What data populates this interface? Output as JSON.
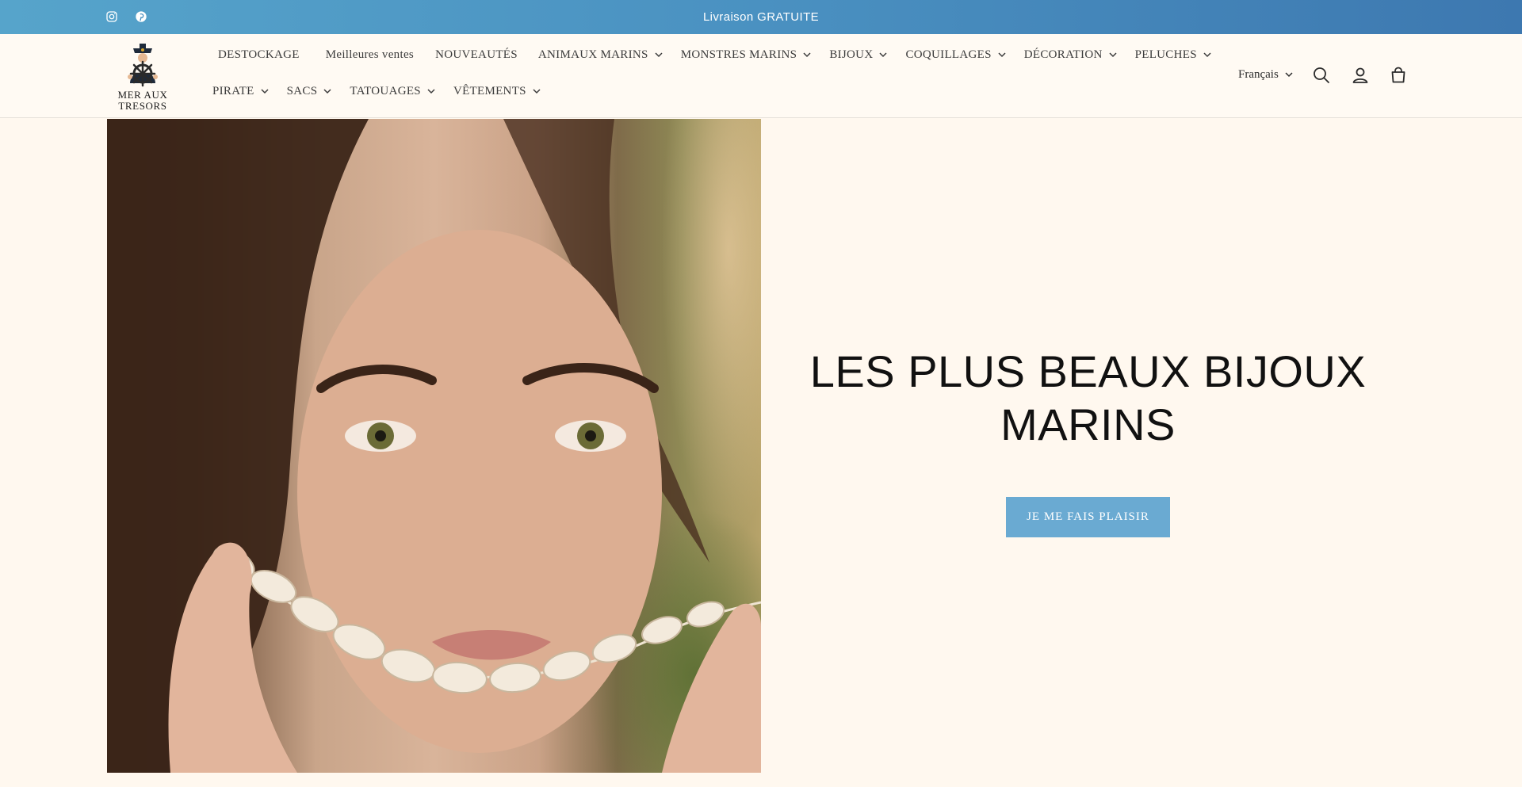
{
  "announcement": {
    "text": "Livraison GRATUITE"
  },
  "social": [
    {
      "icon": "instagram-icon"
    },
    {
      "icon": "pinterest-icon"
    }
  ],
  "logo": {
    "line1": "MER AUX",
    "line2": "TRESORS"
  },
  "nav": {
    "row1": [
      {
        "label": "DESTOCKAGE",
        "dropdown": false
      },
      {
        "label": "Meilleures ventes",
        "dropdown": false
      },
      {
        "label": "NOUVEAUTÉS",
        "dropdown": false
      },
      {
        "label": "ANIMAUX MARINS",
        "dropdown": true
      },
      {
        "label": "MONSTRES MARINS",
        "dropdown": true
      },
      {
        "label": "BIJOUX",
        "dropdown": true
      },
      {
        "label": "COQUILLAGES",
        "dropdown": true
      },
      {
        "label": "DÉCORATION",
        "dropdown": true
      },
      {
        "label": "PELUCHES",
        "dropdown": true
      }
    ],
    "row2": [
      {
        "label": "PIRATE",
        "dropdown": true
      },
      {
        "label": "SACS",
        "dropdown": true
      },
      {
        "label": "TATOUAGES",
        "dropdown": true
      },
      {
        "label": "VÊTEMENTS",
        "dropdown": true
      }
    ]
  },
  "header": {
    "language": "Français",
    "icons": [
      "search-icon",
      "account-icon",
      "cart-icon"
    ]
  },
  "hero": {
    "image_alt": "Femme tenant un collier de coquillages cauris devant son visage",
    "title_line1": "LES PLUS BEAUX BIJOUX",
    "title_line2": "MARINS",
    "button_label": "JE ME FAIS PLAISIR"
  },
  "colors": {
    "announcement_bg_start": "#56a4cb",
    "announcement_bg_end": "#3d78b0",
    "page_bg": "#fff8ef",
    "button_bg": "#6aaad2"
  }
}
